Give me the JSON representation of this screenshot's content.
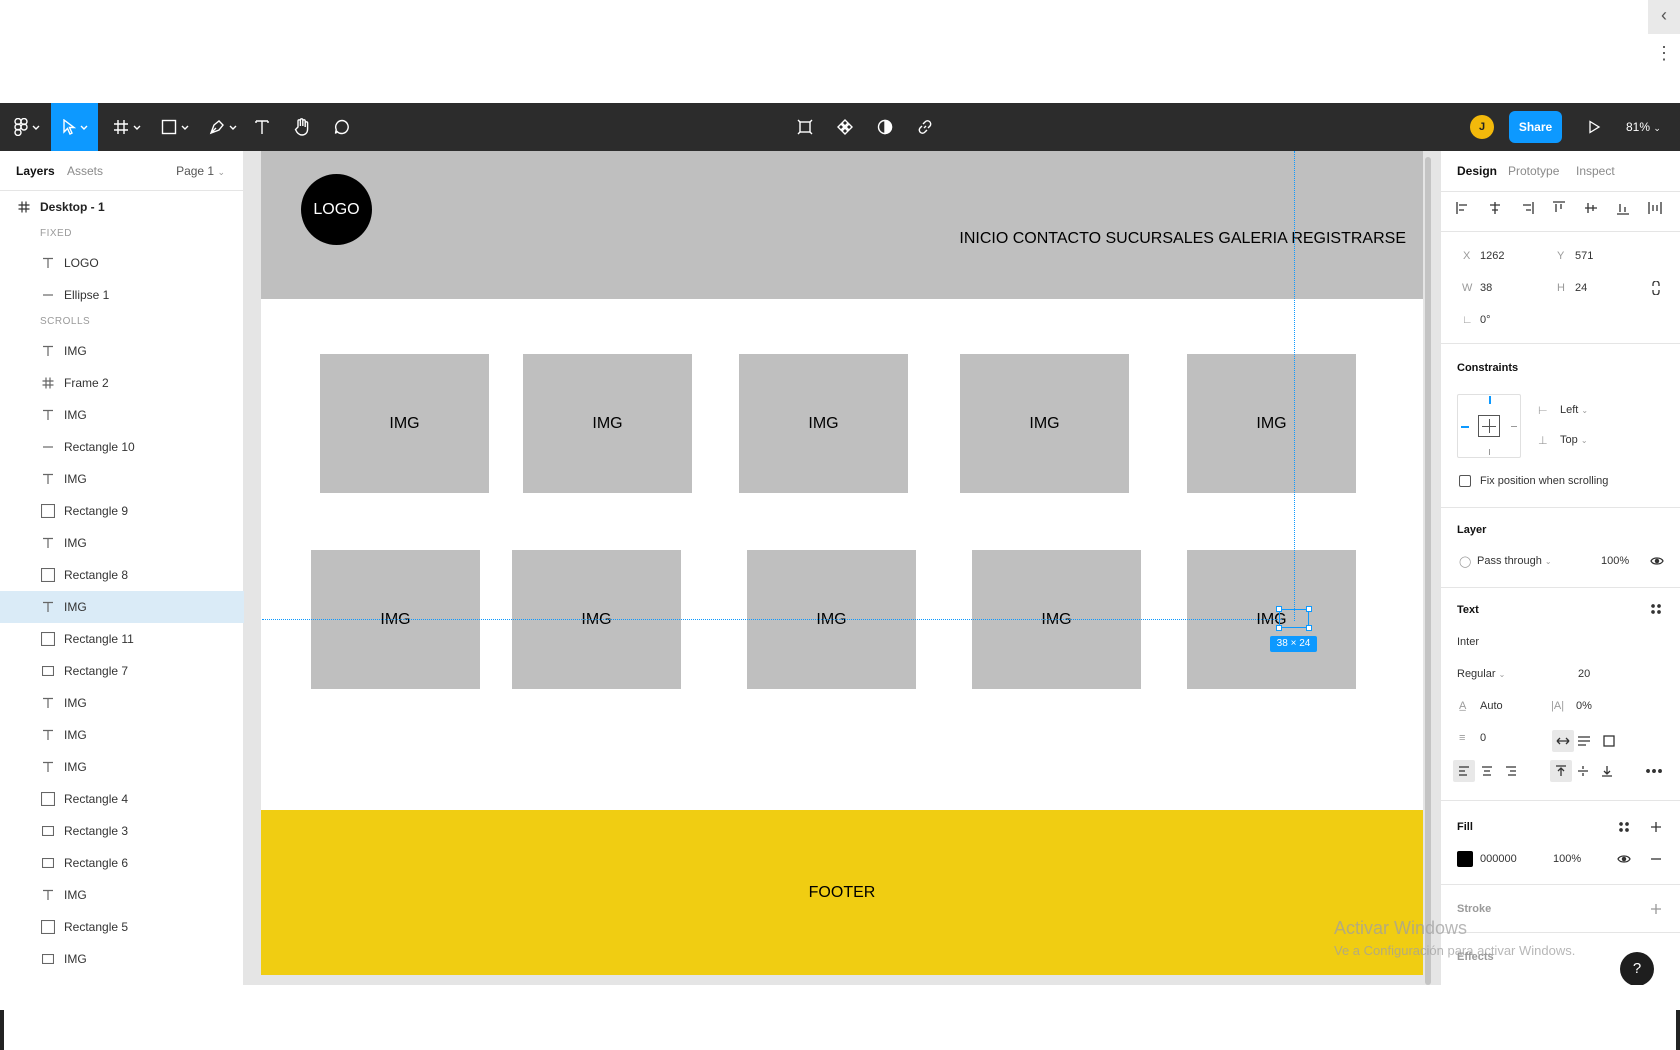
{
  "toolbar": {
    "share_label": "Share",
    "zoom": "81%",
    "avatar_initial": "J"
  },
  "left_panel": {
    "tabs": [
      "Layers",
      "Assets"
    ],
    "page": "Page 1",
    "frame_name": "Desktop - 1",
    "section_fixed": "FIXED",
    "section_scrolls": "SCROLLS",
    "fixed_layers": [
      {
        "icon": "text-icon",
        "name": "LOGO"
      },
      {
        "icon": "line-icon",
        "name": "Ellipse 1"
      }
    ],
    "scroll_layers": [
      {
        "icon": "text-icon",
        "name": "IMG"
      },
      {
        "icon": "frame-icon",
        "name": "Frame 2"
      },
      {
        "icon": "text-icon",
        "name": "IMG"
      },
      {
        "icon": "line-icon",
        "name": "Rectangle 10"
      },
      {
        "icon": "text-icon",
        "name": "IMG"
      },
      {
        "icon": "rectangle-icon",
        "name": "Rectangle 9"
      },
      {
        "icon": "text-icon",
        "name": "IMG"
      },
      {
        "icon": "rectangle-icon",
        "name": "Rectangle 8"
      },
      {
        "icon": "text-icon",
        "name": "IMG",
        "selected": true
      },
      {
        "icon": "rectangle-icon",
        "name": "Rectangle 11"
      },
      {
        "icon": "small-rectangle-icon",
        "name": "Rectangle 7"
      },
      {
        "icon": "text-icon",
        "name": "IMG"
      },
      {
        "icon": "text-icon",
        "name": "IMG"
      },
      {
        "icon": "text-icon",
        "name": "IMG"
      },
      {
        "icon": "rectangle-icon",
        "name": "Rectangle 4"
      },
      {
        "icon": "small-rectangle-icon",
        "name": "Rectangle 3"
      },
      {
        "icon": "small-rectangle-icon",
        "name": "Rectangle 6"
      },
      {
        "icon": "text-icon",
        "name": "IMG"
      },
      {
        "icon": "rectangle-icon",
        "name": "Rectangle 5"
      },
      {
        "icon": "small-rectangle-icon",
        "name": "IMG"
      }
    ]
  },
  "canvas": {
    "logo": "LOGO",
    "nav": "INICIO CONTACTO SUCURSALES GALERIA REGISTRARSE",
    "row1": [
      "IMG",
      "IMG",
      "IMG",
      "IMG",
      "IMG"
    ],
    "row2": [
      "IMG",
      "IMG",
      "IMG",
      "IMG",
      "IMG"
    ],
    "footer": "FOOTER",
    "selection_size": "38 × 24"
  },
  "right_panel": {
    "tabs": [
      "Design",
      "Prototype",
      "Inspect"
    ],
    "x_label": "X",
    "x": "1262",
    "y_label": "Y",
    "y": "571",
    "w_label": "W",
    "w": "38",
    "h_label": "H",
    "h": "24",
    "rotation": "0°",
    "constraints_title": "Constraints",
    "constraint_h": "Left",
    "constraint_v": "Top",
    "fix_position": "Fix position when scrolling",
    "layer_title": "Layer",
    "blend_mode": "Pass through",
    "layer_opacity": "100%",
    "text_title": "Text",
    "font_family": "Inter",
    "font_weight": "Regular",
    "font_size": "20",
    "line_height": "Auto",
    "letter_spacing": "0%",
    "paragraph_spacing": "0",
    "fill_title": "Fill",
    "fill_hex": "000000",
    "fill_opacity": "100%",
    "stroke_title": "Stroke",
    "effects_title": "Effects"
  },
  "watermark": {
    "line1": "Activar Windows",
    "line2": "Ve a Configuración para activar Windows."
  },
  "help_label": "?"
}
